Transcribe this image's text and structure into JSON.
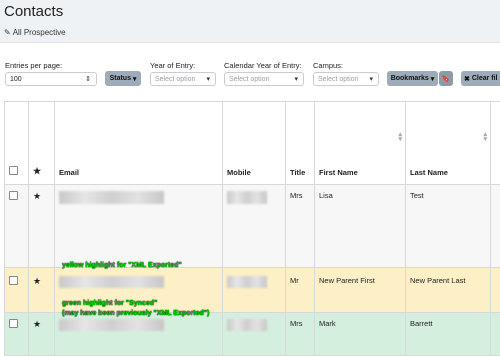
{
  "page": {
    "title": "Contacts",
    "subtitle": "All Prospective"
  },
  "filters": {
    "entries_label": "Entries per page:",
    "entries_value": "100",
    "status_label": "Status",
    "year_entry_label": "Year of Entry:",
    "year_entry_placeholder": "Select option",
    "cal_year_label": "Calendar Year of Entry:",
    "cal_year_placeholder": "Select option",
    "campus_label": "Campus:",
    "campus_placeholder": "Select option",
    "bookmarks_label": "Bookmarks",
    "clear_label": "Clear fil"
  },
  "table": {
    "headers": {
      "email": "Email",
      "mobile": "Mobile",
      "title": "Title",
      "first": "First Name",
      "last": "Last Name"
    },
    "rows": [
      {
        "title": "Mrs",
        "first": "Lisa",
        "last": "Test",
        "highlight": "none"
      },
      {
        "title": "Mr",
        "first": "New Parent First",
        "last": "New Parent Last",
        "highlight": "yellow",
        "note": "yellow highlight  for \"XML Exported\""
      },
      {
        "title": "Mrs",
        "first": "Mark",
        "last": "Barrett",
        "highlight": "green",
        "note1": "green highlight  for \"Synced\"",
        "note2": "(may have been previously \"XML Exported\")"
      }
    ]
  },
  "colors": {
    "yellow_row": "#fdf0c6",
    "green_row": "#d5efdf",
    "note_text": "#00d000",
    "header_bg": "#eff2f5"
  },
  "icons": {
    "subtitle": "edit-icon",
    "star": "star-icon",
    "sort": "sort-icon",
    "bookmark": "bookmark-icon",
    "clear": "x-icon"
  }
}
